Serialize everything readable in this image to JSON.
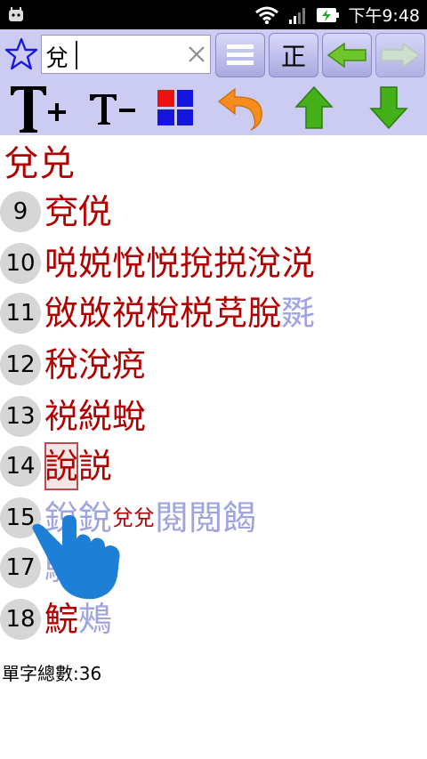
{
  "status_bar": {
    "time": "下午9:48"
  },
  "search": {
    "value": "兌"
  },
  "toolbar": {
    "zheng_label": "正"
  },
  "root_chars": [
    "兌",
    "兑"
  ],
  "rows": [
    {
      "count": "9",
      "chars": [
        {
          "c": "兗",
          "lite": false
        },
        {
          "c": "侻",
          "lite": false
        }
      ]
    },
    {
      "count": "10",
      "chars": [
        {
          "c": "哾",
          "lite": false
        },
        {
          "c": "娧",
          "lite": false
        },
        {
          "c": "悅",
          "lite": false
        },
        {
          "c": "悦",
          "lite": false
        },
        {
          "c": "挩",
          "lite": false
        },
        {
          "c": "捝",
          "lite": false
        },
        {
          "c": "涗",
          "lite": false
        },
        {
          "c": "涚",
          "lite": false
        }
      ]
    },
    {
      "count": "11",
      "chars": [
        {
          "c": "敓",
          "lite": false
        },
        {
          "c": "敚",
          "lite": false
        },
        {
          "c": "祱",
          "lite": false
        },
        {
          "c": "梲",
          "lite": false
        },
        {
          "c": "棁",
          "lite": false
        },
        {
          "c": "莌",
          "lite": false
        },
        {
          "c": "脫",
          "lite": false
        },
        {
          "c": "毲",
          "lite": true
        }
      ]
    },
    {
      "count": "12",
      "chars": [
        {
          "c": "稅",
          "lite": false
        },
        {
          "c": "涗",
          "lite": false
        },
        {
          "c": "痥",
          "lite": false
        }
      ]
    },
    {
      "count": "13",
      "chars": [
        {
          "c": "裞",
          "lite": false
        },
        {
          "c": "綐",
          "lite": false
        },
        {
          "c": "蛻",
          "lite": false
        }
      ]
    },
    {
      "count": "14",
      "chars": [
        {
          "c": "說",
          "lite": false,
          "sel": true
        },
        {
          "c": "説",
          "lite": false
        }
      ]
    },
    {
      "count": "15",
      "chars": [
        {
          "c": "銳",
          "lite": true
        },
        {
          "c": "銳",
          "lite": true
        },
        {
          "c": "兌",
          "lite": false,
          "small": true
        },
        {
          "c": "兌",
          "lite": false,
          "small": true
        },
        {
          "c": "閱",
          "lite": true
        },
        {
          "c": "閲",
          "lite": true
        },
        {
          "c": "餲",
          "lite": true
        }
      ]
    },
    {
      "count": "17",
      "chars": [
        {
          "c": "駾",
          "lite": true
        }
      ]
    },
    {
      "count": "18",
      "chars": [
        {
          "c": "鯇",
          "lite": false
        },
        {
          "c": "鵊",
          "lite": true
        }
      ]
    }
  ],
  "total_label": "單字總數:36",
  "colors": {
    "toolbar_bg": "#ccccf2",
    "char_red": "#b10000",
    "char_lite": "#9fa3e0",
    "arrow_green": "#44b01a",
    "hand_blue": "#1e7fd6"
  }
}
